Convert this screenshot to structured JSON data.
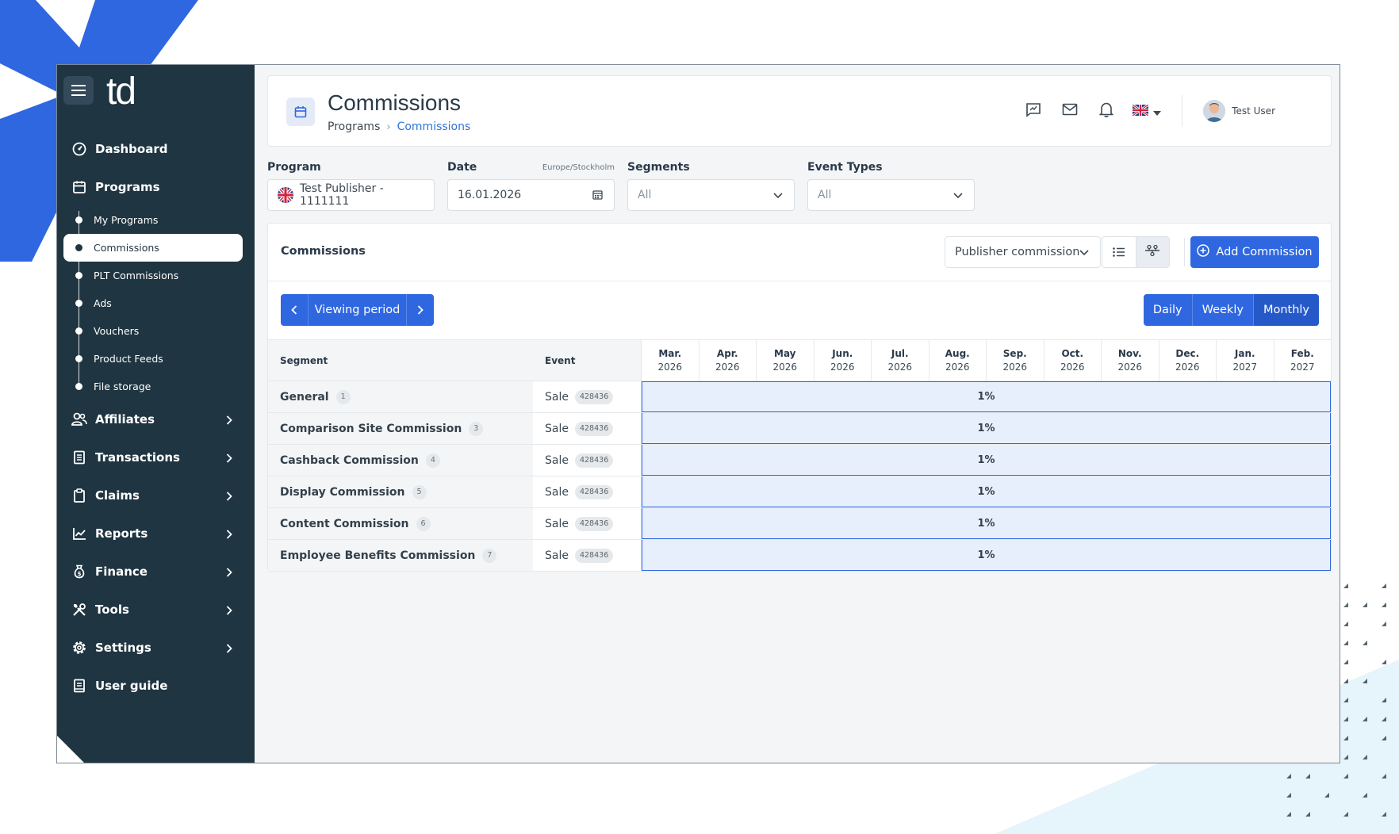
{
  "app": {
    "logo_text": "td"
  },
  "sidebar": {
    "items": [
      {
        "label": "Dashboard",
        "icon": "dashboard-icon"
      },
      {
        "label": "Programs",
        "icon": "programs-icon"
      },
      {
        "label": "Affiliates",
        "icon": "affiliates-icon"
      },
      {
        "label": "Transactions",
        "icon": "transactions-icon"
      },
      {
        "label": "Claims",
        "icon": "claims-icon"
      },
      {
        "label": "Reports",
        "icon": "reports-icon"
      },
      {
        "label": "Finance",
        "icon": "finance-icon"
      },
      {
        "label": "Tools",
        "icon": "tools-icon"
      },
      {
        "label": "Settings",
        "icon": "settings-icon"
      },
      {
        "label": "User guide",
        "icon": "user-guide-icon"
      }
    ],
    "programs_sub": [
      {
        "label": "My Programs"
      },
      {
        "label": "Commissions",
        "active": true
      },
      {
        "label": "PLT Commissions"
      },
      {
        "label": "Ads"
      },
      {
        "label": "Vouchers"
      },
      {
        "label": "Product Feeds"
      },
      {
        "label": "File storage"
      }
    ]
  },
  "header": {
    "title": "Commissions",
    "breadcrumb": [
      "Programs",
      "Commissions"
    ],
    "user_name": "Test User"
  },
  "filters": {
    "program": {
      "label": "Program",
      "value": "Test Publisher - 1111111"
    },
    "date": {
      "label": "Date",
      "hint": "Europe/Stockholm",
      "value": "16.01.2026"
    },
    "segments": {
      "label": "Segments",
      "value": "All"
    },
    "event_types": {
      "label": "Event Types",
      "value": "All"
    }
  },
  "commissions": {
    "title": "Commissions",
    "commission_type": "Publisher commission",
    "add_label": "Add Commission",
    "viewing_period": "Viewing period",
    "ranges": [
      "Daily",
      "Weekly",
      "Monthly"
    ],
    "active_range": "Monthly",
    "columns": {
      "segment": "Segment",
      "event": "Event"
    },
    "months": [
      {
        "m": "Mar.",
        "y": "2026"
      },
      {
        "m": "Apr.",
        "y": "2026"
      },
      {
        "m": "May",
        "y": "2026"
      },
      {
        "m": "Jun.",
        "y": "2026"
      },
      {
        "m": "Jul.",
        "y": "2026"
      },
      {
        "m": "Aug.",
        "y": "2026"
      },
      {
        "m": "Sep.",
        "y": "2026"
      },
      {
        "m": "Oct.",
        "y": "2026"
      },
      {
        "m": "Nov.",
        "y": "2026"
      },
      {
        "m": "Dec.",
        "y": "2026"
      },
      {
        "m": "Jan.",
        "y": "2027"
      },
      {
        "m": "Feb.",
        "y": "2027"
      }
    ],
    "rows": [
      {
        "segment": "General",
        "count": "1",
        "event": "Sale",
        "event_id": "428436",
        "value": "1%"
      },
      {
        "segment": "Comparison Site Commission",
        "count": "3",
        "event": "Sale",
        "event_id": "428436",
        "value": "1%"
      },
      {
        "segment": "Cashback Commission",
        "count": "4",
        "event": "Sale",
        "event_id": "428436",
        "value": "1%"
      },
      {
        "segment": "Display Commission",
        "count": "5",
        "event": "Sale",
        "event_id": "428436",
        "value": "1%"
      },
      {
        "segment": "Content Commission",
        "count": "6",
        "event": "Sale",
        "event_id": "428436",
        "value": "1%"
      },
      {
        "segment": "Employee Benefits Commission",
        "count": "7",
        "event": "Sale",
        "event_id": "428436",
        "value": "1%"
      }
    ]
  },
  "colors": {
    "sidebar_bg": "#1f3541",
    "accent": "#2f67e0",
    "cell_bg": "#e8effc"
  }
}
